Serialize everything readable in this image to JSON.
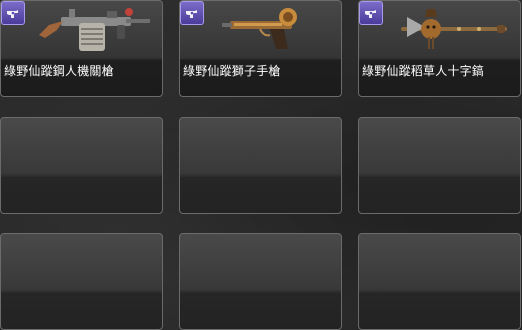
{
  "inventory": {
    "items": [
      {
        "name": "綠野仙蹤鋼人機關槍",
        "icon": "revolver-icon"
      },
      {
        "name": "綠野仙蹤獅子手槍",
        "icon": "revolver-icon"
      },
      {
        "name": "綠野仙蹤稻草人十字鎬",
        "icon": "revolver-icon"
      }
    ],
    "empty_slot_count": 6
  },
  "colors": {
    "badge": "#5b4bb0",
    "slot_border": "#6b6b6b",
    "label_text": "#ffffff"
  }
}
